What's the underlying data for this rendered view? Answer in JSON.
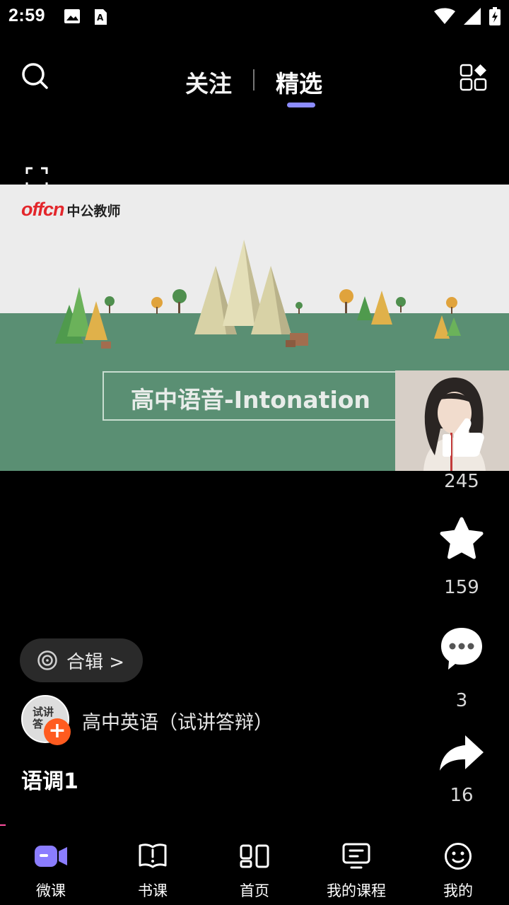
{
  "status_bar": {
    "time": "2:59"
  },
  "top_nav": {
    "tab_follow": "关注",
    "tab_featured": "精选"
  },
  "video": {
    "logo_mark": "offcn",
    "logo_text": "中公教师",
    "title": "高中语音-Intonation"
  },
  "actions": {
    "likes": "245",
    "favorites": "159",
    "comments": "3",
    "shares": "16"
  },
  "collection": {
    "label": "合辑 >"
  },
  "author": {
    "avatar_text": "试讲\n答",
    "follow_symbol": "+",
    "name": "高中英语（试讲答辩）"
  },
  "caption": "语调1",
  "bottom_nav": {
    "items": [
      {
        "label": "微课",
        "icon": "video-camera-icon"
      },
      {
        "label": "书课",
        "icon": "book-icon"
      },
      {
        "label": "首页",
        "icon": "home-grid-icon"
      },
      {
        "label": "我的课程",
        "icon": "monitor-course-icon"
      },
      {
        "label": "我的",
        "icon": "smiley-icon"
      }
    ]
  },
  "colors": {
    "tab_indicator": "#8c8cff",
    "follow_plus": "#ff5b1f",
    "video_green": "#5a8f73",
    "nav_active": "#8b7dff"
  }
}
